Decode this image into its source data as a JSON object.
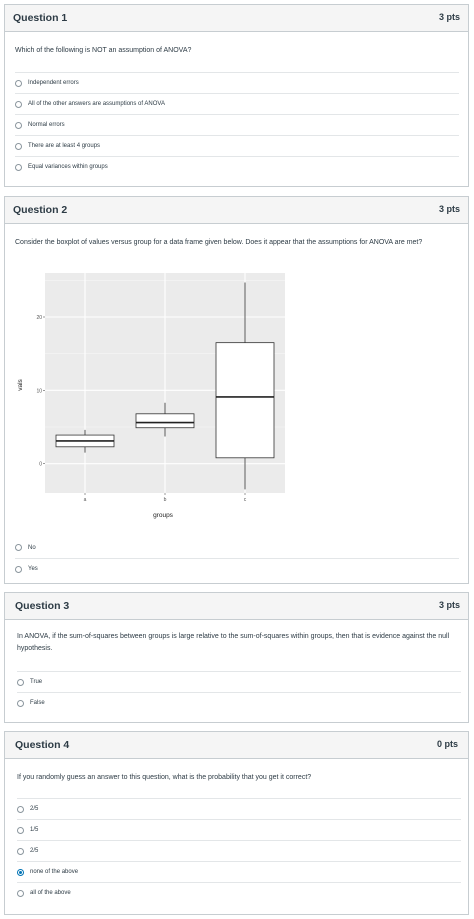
{
  "q1": {
    "title": "Question 1",
    "points": "3 pts",
    "text": "Which of the following is NOT an assumption of ANOVA?",
    "options": [
      {
        "label": "Independent errors"
      },
      {
        "label": "All of the other answers are assumptions of ANOVA"
      },
      {
        "label": "Normal errors"
      },
      {
        "label": "There are at least 4 groups"
      },
      {
        "label": "Equal variances within groups"
      }
    ]
  },
  "q2": {
    "title": "Question 2",
    "points": "3 pts",
    "text": "Consider the boxplot of values versus group for a data frame given below. Does it appear that the assumptions for ANOVA are met?",
    "options": [
      {
        "label": "No"
      },
      {
        "label": "Yes"
      }
    ]
  },
  "q3": {
    "title": "Question 3",
    "points": "3 pts",
    "text": "In ANOVA, if the sum-of-squares between groups is large relative to the sum-of-squares within groups, then that is evidence against the null hypothesis.",
    "options": [
      {
        "label": "True"
      },
      {
        "label": "False"
      }
    ]
  },
  "q4": {
    "title": "Question 4",
    "points": "0 pts",
    "text": "If you randomly guess an answer to this question, what is the probability that you get it correct?",
    "options": [
      {
        "label": "2/5"
      },
      {
        "label": "1/5"
      },
      {
        "label": "2/5"
      },
      {
        "label": "none of the above",
        "selected": true
      },
      {
        "label": "all of the above"
      }
    ]
  },
  "chart_data": {
    "type": "boxplot",
    "xlabel": "groups",
    "ylabel": "vals",
    "categories": [
      "a",
      "b",
      "c"
    ],
    "yticks": [
      0,
      10,
      20
    ],
    "ylim": [
      -4,
      26
    ],
    "grid": true,
    "boxes": [
      {
        "category": "a",
        "whisker_low": 1.5,
        "q1": 2.3,
        "median": 3.1,
        "q3": 3.9,
        "whisker_high": 4.6
      },
      {
        "category": "b",
        "whisker_low": 3.7,
        "q1": 4.9,
        "median": 5.6,
        "q3": 6.8,
        "whisker_high": 8.3
      },
      {
        "category": "c",
        "whisker_low": -3.5,
        "q1": 0.8,
        "median": 9.1,
        "q3": 16.5,
        "whisker_high": 24.7
      }
    ]
  }
}
